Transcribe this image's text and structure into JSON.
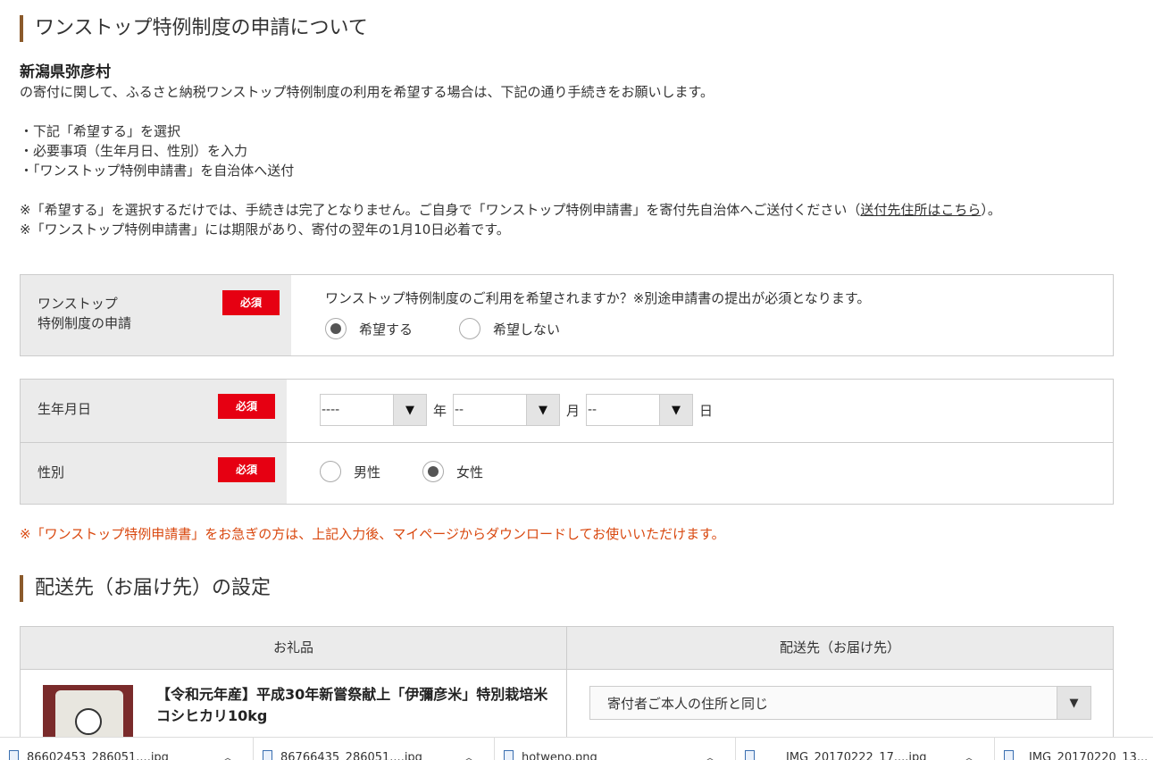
{
  "onestop": {
    "title": "ワンストップ特例制度の申請について",
    "municipality": "新潟県弥彦村",
    "intro": "の寄付に関して、ふるさと納税ワンストップ特例制度の利用を希望する場合は、下記の通り手続きをお願いします。",
    "steps": [
      "・下記「希望する」を選択",
      "・必要事項（生年月日、性別）を入力",
      "・「ワンストップ特例申請書」を自治体へ送付"
    ],
    "note1_prefix": "※「希望する」を選択するだけでは、手続きは完了となりません。ご自身で「ワンストップ特例申請書」を寄付先自治体へご送付ください（",
    "note1_link": "送付先住所はこちら",
    "note1_suffix": "）。",
    "note2": "※「ワンストップ特例申請書」には期限があり、寄付の翌年の1月10日必着です。"
  },
  "form": {
    "required_badge": "必須",
    "apply": {
      "label_line1": "ワンストップ",
      "label_line2": "特例制度の申請",
      "question": "ワンストップ特例制度のご利用を希望されますか？※別途申請書の提出が必須となります。",
      "option_yes": "希望する",
      "option_no": "希望しない",
      "selected": "希望する"
    },
    "birth": {
      "label": "生年月日",
      "year_value": "----",
      "year_unit": "年",
      "month_value": "--",
      "month_unit": "月",
      "day_value": "--",
      "day_unit": "日"
    },
    "gender": {
      "label": "性別",
      "option_male": "男性",
      "option_female": "女性",
      "selected": "女性"
    },
    "notice": "※「ワンストップ特例申請書」をお急ぎの方は、上記入力後、マイページからダウンロードしてお使いいただけます。"
  },
  "delivery": {
    "title": "配送先（お届け先）の設定",
    "col_gift": "お礼品",
    "col_destination": "配送先（お届け先）",
    "item_name": "【令和元年産】平成30年新嘗祭献上「伊彌彦米」特別栽培米コシヒカリ10kg",
    "destination_value": "寄付者ご本人の住所と同じ"
  },
  "downloads": [
    {
      "name": "86602453_286051....jpg"
    },
    {
      "name": "86766435_286051....jpg"
    },
    {
      "name": "hotweno.png"
    },
    {
      "name": "IMG_20170222_17....jpg"
    },
    {
      "name": "IMG_20170220_13..."
    }
  ],
  "colors": {
    "accent_bar": "#8b5a2b",
    "required_red": "#e60012",
    "notice_orange": "#d9480f"
  }
}
